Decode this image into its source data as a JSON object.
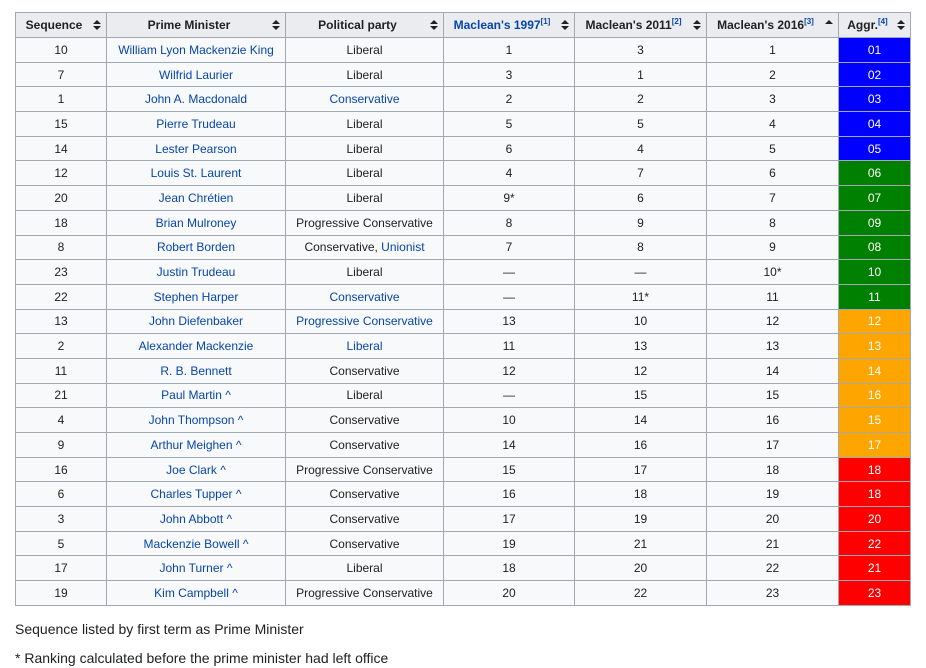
{
  "headers": [
    {
      "label": "Sequence",
      "link": false,
      "ref": "",
      "sort": "both"
    },
    {
      "label": "Prime Minister",
      "link": false,
      "ref": "",
      "sort": "both"
    },
    {
      "label": "Political party",
      "link": false,
      "ref": "",
      "sort": "both"
    },
    {
      "label": "Maclean's 1997",
      "link": true,
      "ref": "[1]",
      "sort": "both"
    },
    {
      "label": "Maclean's 2011",
      "link": false,
      "ref": "[2]",
      "sort": "both"
    },
    {
      "label": "Maclean's 2016",
      "link": false,
      "ref": "[3]",
      "sort": "up"
    },
    {
      "label": "Aggr.",
      "link": false,
      "ref": "[4]",
      "sort": "both"
    }
  ],
  "colors": {
    "blue": "#0000ff",
    "green": "#008000",
    "orange": "#ffa500",
    "red": "#ff0000"
  },
  "rows": [
    {
      "seq": "10",
      "pm": "William Lyon Mackenzie King",
      "party": [
        {
          "t": "Liberal",
          "link": false
        }
      ],
      "m1997": "1",
      "m2011": "3",
      "m2016": "1",
      "aggr": "01",
      "color": "blue"
    },
    {
      "seq": "7",
      "pm": "Wilfrid Laurier",
      "party": [
        {
          "t": "Liberal",
          "link": false
        }
      ],
      "m1997": "3",
      "m2011": "1",
      "m2016": "2",
      "aggr": "02",
      "color": "blue"
    },
    {
      "seq": "1",
      "pm": "John A. Macdonald",
      "party": [
        {
          "t": "Conservative",
          "link": true
        }
      ],
      "m1997": "2",
      "m2011": "2",
      "m2016": "3",
      "aggr": "03",
      "color": "blue"
    },
    {
      "seq": "15",
      "pm": "Pierre Trudeau",
      "party": [
        {
          "t": "Liberal",
          "link": false
        }
      ],
      "m1997": "5",
      "m2011": "5",
      "m2016": "4",
      "aggr": "04",
      "color": "blue"
    },
    {
      "seq": "14",
      "pm": "Lester Pearson",
      "party": [
        {
          "t": "Liberal",
          "link": false
        }
      ],
      "m1997": "6",
      "m2011": "4",
      "m2016": "5",
      "aggr": "05",
      "color": "blue"
    },
    {
      "seq": "12",
      "pm": "Louis St. Laurent",
      "party": [
        {
          "t": "Liberal",
          "link": false
        }
      ],
      "m1997": "4",
      "m2011": "7",
      "m2016": "6",
      "aggr": "06",
      "color": "green"
    },
    {
      "seq": "20",
      "pm": "Jean Chrétien",
      "party": [
        {
          "t": "Liberal",
          "link": false
        }
      ],
      "m1997": "9*",
      "m2011": "6",
      "m2016": "7",
      "aggr": "07",
      "color": "green"
    },
    {
      "seq": "18",
      "pm": "Brian Mulroney",
      "party": [
        {
          "t": "Progressive Conservative",
          "link": false
        }
      ],
      "m1997": "8",
      "m2011": "9",
      "m2016": "8",
      "aggr": "09",
      "color": "green"
    },
    {
      "seq": "8",
      "pm": "Robert Borden",
      "party": [
        {
          "t": "Conservative, ",
          "link": false
        },
        {
          "t": "Unionist",
          "link": true
        }
      ],
      "m1997": "7",
      "m2011": "8",
      "m2016": "9",
      "aggr": "08",
      "color": "green"
    },
    {
      "seq": "23",
      "pm": "Justin Trudeau",
      "party": [
        {
          "t": "Liberal",
          "link": false
        }
      ],
      "m1997": "—",
      "m2011": "—",
      "m2016": "10*",
      "aggr": "10",
      "color": "green"
    },
    {
      "seq": "22",
      "pm": "Stephen Harper",
      "party": [
        {
          "t": "Conservative",
          "link": true
        }
      ],
      "m1997": "—",
      "m2011": "11*",
      "m2016": "11",
      "aggr": "11",
      "color": "green"
    },
    {
      "seq": "13",
      "pm": "John Diefenbaker",
      "party": [
        {
          "t": "Progressive Conservative",
          "link": true
        }
      ],
      "m1997": "13",
      "m2011": "10",
      "m2016": "12",
      "aggr": "12",
      "color": "orange"
    },
    {
      "seq": "2",
      "pm": "Alexander Mackenzie",
      "party": [
        {
          "t": "Liberal",
          "link": true
        }
      ],
      "m1997": "11",
      "m2011": "13",
      "m2016": "13",
      "aggr": "13",
      "color": "orange"
    },
    {
      "seq": "11",
      "pm": "R. B. Bennett",
      "party": [
        {
          "t": "Conservative",
          "link": false
        }
      ],
      "m1997": "12",
      "m2011": "12",
      "m2016": "14",
      "aggr": "14",
      "color": "orange"
    },
    {
      "seq": "21",
      "pm": "Paul Martin ^",
      "party": [
        {
          "t": "Liberal",
          "link": false
        }
      ],
      "m1997": "—",
      "m2011": "15",
      "m2016": "15",
      "aggr": "16",
      "color": "orange"
    },
    {
      "seq": "4",
      "pm": "John Thompson ^",
      "party": [
        {
          "t": "Conservative",
          "link": false
        }
      ],
      "m1997": "10",
      "m2011": "14",
      "m2016": "16",
      "aggr": "15",
      "color": "orange"
    },
    {
      "seq": "9",
      "pm": "Arthur Meighen ^",
      "party": [
        {
          "t": "Conservative",
          "link": false
        }
      ],
      "m1997": "14",
      "m2011": "16",
      "m2016": "17",
      "aggr": "17",
      "color": "orange"
    },
    {
      "seq": "16",
      "pm": "Joe Clark ^",
      "party": [
        {
          "t": "Progressive Conservative",
          "link": false
        }
      ],
      "m1997": "15",
      "m2011": "17",
      "m2016": "18",
      "aggr": "18",
      "color": "red"
    },
    {
      "seq": "6",
      "pm": "Charles Tupper ^",
      "party": [
        {
          "t": "Conservative",
          "link": false
        }
      ],
      "m1997": "16",
      "m2011": "18",
      "m2016": "19",
      "aggr": "18",
      "color": "red"
    },
    {
      "seq": "3",
      "pm": "John Abbott ^",
      "party": [
        {
          "t": "Conservative",
          "link": false
        }
      ],
      "m1997": "17",
      "m2011": "19",
      "m2016": "20",
      "aggr": "20",
      "color": "red"
    },
    {
      "seq": "5",
      "pm": "Mackenzie Bowell ^",
      "party": [
        {
          "t": "Conservative",
          "link": false
        }
      ],
      "m1997": "19",
      "m2011": "21",
      "m2016": "21",
      "aggr": "22",
      "color": "red"
    },
    {
      "seq": "17",
      "pm": "John Turner ^",
      "party": [
        {
          "t": "Liberal",
          "link": false
        }
      ],
      "m1997": "18",
      "m2011": "20",
      "m2016": "22",
      "aggr": "21",
      "color": "red"
    },
    {
      "seq": "19",
      "pm": "Kim Campbell ^",
      "party": [
        {
          "t": "Progressive Conservative",
          "link": false
        }
      ],
      "m1997": "20",
      "m2011": "22",
      "m2016": "23",
      "aggr": "23",
      "color": "red"
    }
  ],
  "notes": {
    "sequence": "Sequence listed by first term as Prime Minister",
    "asterisk": "* Ranking calculated before the prime minister had left office"
  }
}
